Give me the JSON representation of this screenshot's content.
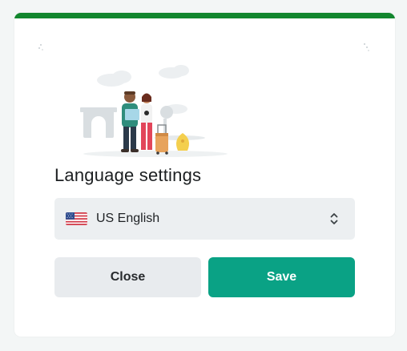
{
  "dialog": {
    "accent_color": "#12862e",
    "illustration": "travelers-with-luggage-illustration",
    "title": "Language settings"
  },
  "language_select": {
    "selected_value": "US English",
    "flag_icon": "us-flag-icon",
    "chevron_icon": "chevron-up-down-icon"
  },
  "buttons": {
    "close_label": "Close",
    "save_label": "Save",
    "save_color": "#0aa285"
  }
}
